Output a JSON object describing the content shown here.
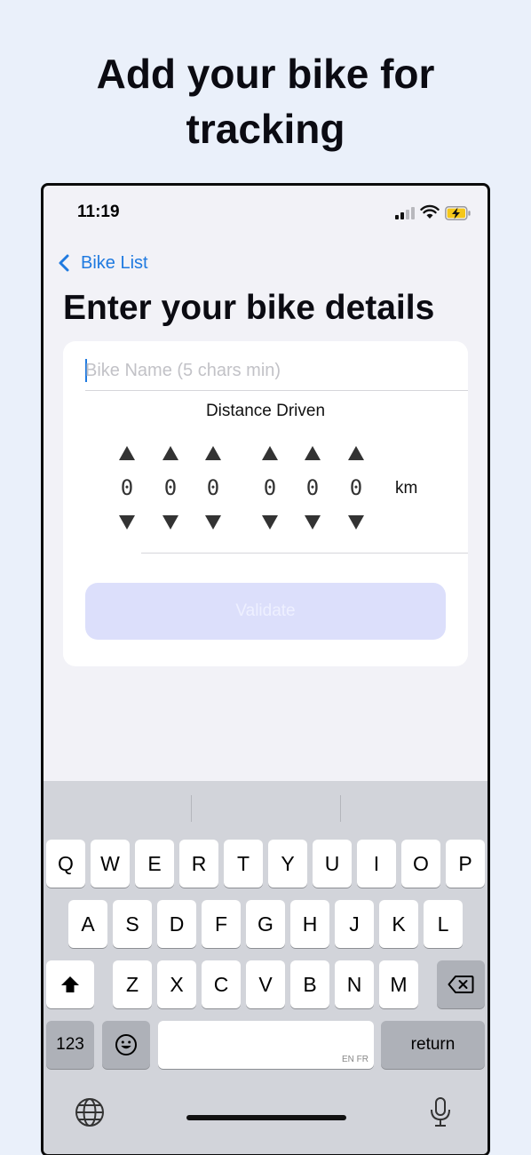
{
  "hero": {
    "title_line1": "Add your bike for",
    "title_line2": "tracking"
  },
  "status_bar": {
    "time": "11:19"
  },
  "nav": {
    "back_label": "Bike List"
  },
  "form": {
    "heading": "Enter your bike details",
    "name_placeholder": "Bike Name (5 chars min)",
    "name_value": "",
    "distance_label": "Distance Driven",
    "distance_digits": [
      "0",
      "0",
      "0",
      "0",
      "0",
      "0"
    ],
    "unit": "km",
    "validate_label": "Validate"
  },
  "keyboard": {
    "row1": [
      "Q",
      "W",
      "E",
      "R",
      "T",
      "Y",
      "U",
      "I",
      "O",
      "P"
    ],
    "row2": [
      "A",
      "S",
      "D",
      "F",
      "G",
      "H",
      "J",
      "K",
      "L"
    ],
    "row3": [
      "Z",
      "X",
      "C",
      "V",
      "B",
      "N",
      "M"
    ],
    "numbers_label": "123",
    "return_label": "return",
    "space_lang": "EN FR",
    "shift_icon": "shift-icon",
    "delete_icon": "delete-icon",
    "emoji_icon": "emoji-icon",
    "globe_icon": "globe-icon",
    "mic_icon": "microphone-icon"
  },
  "colors": {
    "accent": "#1f7ae0",
    "button_disabled": "#dcdffb",
    "background": "#eaf0fa"
  }
}
